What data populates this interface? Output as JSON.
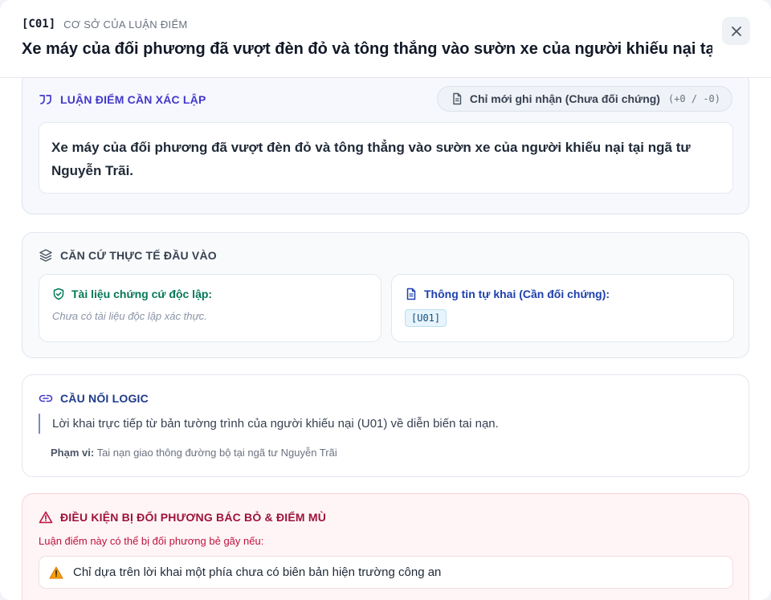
{
  "header": {
    "code": "[C01]",
    "eyebrow": "CƠ SỞ CỦA LUẬN ĐIỂM",
    "title": "Xe máy của đối phương đã vượt đèn đỏ và tông thẳng vào sườn xe của người khiếu nại tại ..."
  },
  "claim": {
    "heading": "LUẬN ĐIỂM CẦN XÁC LẬP",
    "status": "Chỉ mới ghi nhận (Chưa đối chứng)",
    "delta": "(+0 / -0)",
    "text": "Xe máy của đối phương đã vượt đèn đỏ và tông thẳng vào sườn xe của người khiếu nại tại ngã tư Nguyễn Trãi."
  },
  "facts": {
    "heading": "CĂN CỨ THỰC TẾ ĐẦU VÀO",
    "independent_label": "Tài liệu chứng cứ độc lập:",
    "independent_empty": "Chưa có tài liệu độc lập xác thực.",
    "self_label": "Thông tin tự khai (Cần đối chứng):",
    "self_tag": "[U01]"
  },
  "logic": {
    "heading": "CẦU NỐI LOGIC",
    "text": "Lời khai trực tiếp từ bản tường trình của người khiếu nại (U01) về diễn biến tai nạn.",
    "scope_label": "Phạm vi:",
    "scope_value": "Tai nạn giao thông đường bộ tại ngã tư Nguyễn Trãi"
  },
  "risk": {
    "heading": "ĐIỀU KIỆN BỊ ĐỐI PHƯƠNG BÁC BỎ & ĐIỂM MÙ",
    "intro": "Luận điểm này có thể bị đối phương bẻ gãy nếu:",
    "items": [
      "Chỉ dựa trên lời khai một phía chưa có biên bản hiện trường công an"
    ]
  },
  "colors": {
    "indigo": "#4338ca",
    "slate": "#374151",
    "green": "#047857",
    "blue": "#1e40af",
    "navy": "#1e3a8a",
    "rose": "#9f1239"
  }
}
